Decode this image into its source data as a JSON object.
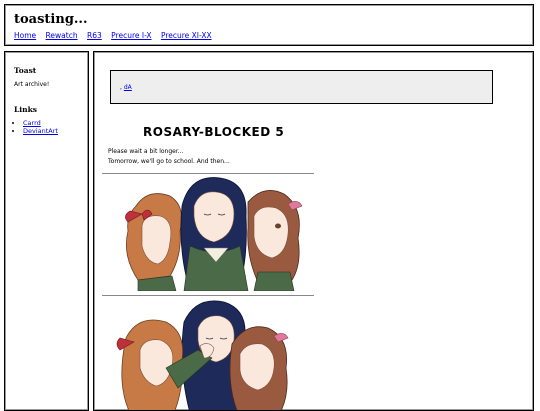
{
  "header": {
    "title": "toasting...",
    "nav": [
      "Home",
      "Rewatch",
      "R63",
      "Precure I-X",
      "Precure XI-XX"
    ]
  },
  "sidebar": {
    "section1_title": "Toast",
    "section1_text": "Art archive!",
    "section2_title": "Links",
    "links": [
      "Carrd",
      "DeviantArt"
    ]
  },
  "main": {
    "info_prefix": ", ",
    "info_link": "dA",
    "comic_title": "ROSARY-BLOCKED 5",
    "caption_line1": "Please wait a bit longer...",
    "caption_line2": "Tomorrow, we'll go to school. And then..."
  },
  "colors": {
    "link": "#0000ee",
    "info_bg": "#eeeeee",
    "hair_dark": "#1e2a5a",
    "hair_brown": "#b86a3a",
    "hair_auburn": "#8a4a35",
    "uniform_green": "#4a6a48",
    "ribbon_red": "#c0303a",
    "ribbon_pink": "#e07a9a"
  }
}
